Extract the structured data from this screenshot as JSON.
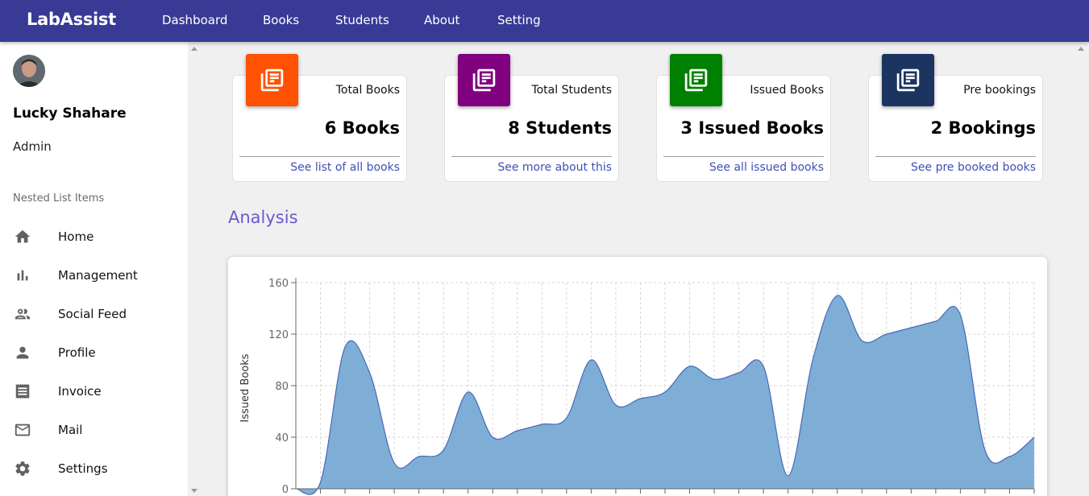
{
  "app": {
    "brand": "LabAssist"
  },
  "nav": {
    "items": [
      "Dashboard",
      "Books",
      "Students",
      "About",
      "Setting"
    ]
  },
  "user": {
    "name": "Lucky Shahare",
    "role": "Admin"
  },
  "sidebar": {
    "section_label": "Nested List Items",
    "items": [
      {
        "label": "Home",
        "icon": "home-icon"
      },
      {
        "label": "Management",
        "icon": "bar-chart-icon"
      },
      {
        "label": "Social Feed",
        "icon": "people-icon"
      },
      {
        "label": "Profile",
        "icon": "person-icon"
      },
      {
        "label": "Invoice",
        "icon": "receipt-icon"
      },
      {
        "label": "Mail",
        "icon": "mail-icon"
      },
      {
        "label": "Settings",
        "icon": "gear-icon"
      }
    ]
  },
  "stats": [
    {
      "title": "Total Books",
      "value": "6 Books",
      "link": "See list of all books",
      "color": "#ff5100",
      "icon": "library-books-icon"
    },
    {
      "title": "Total Students",
      "value": "8 Students",
      "link": "See more about this",
      "color": "#800080",
      "icon": "library-books-icon"
    },
    {
      "title": "Issued Books",
      "value": "3 Issued Books",
      "link": "See all issued books",
      "color": "#008000",
      "icon": "library-books-icon"
    },
    {
      "title": "Pre bookings",
      "value": "2 Bookings",
      "link": "See pre booked books",
      "color": "#1b3560",
      "icon": "library-books-icon"
    }
  ],
  "analysis": {
    "heading": "Analysis"
  },
  "colors": {
    "nav_bg": "#393a96",
    "area_fill": "#7eaed6",
    "area_stroke": "#4a68b8",
    "link": "#3f51b5"
  },
  "chart_data": {
    "type": "area",
    "ylabel": "Issued Books",
    "ylim": [
      0,
      160
    ],
    "yticks": [
      0,
      40,
      80,
      120,
      160
    ],
    "grid": true,
    "series": [
      {
        "values": [
          0,
          5,
          110,
          90,
          20,
          25,
          30,
          75,
          40,
          45,
          50,
          55,
          100,
          65,
          70,
          75,
          95,
          85,
          90,
          95,
          10,
          100,
          150,
          115,
          120,
          125,
          130,
          135,
          30,
          25,
          40
        ]
      }
    ]
  }
}
